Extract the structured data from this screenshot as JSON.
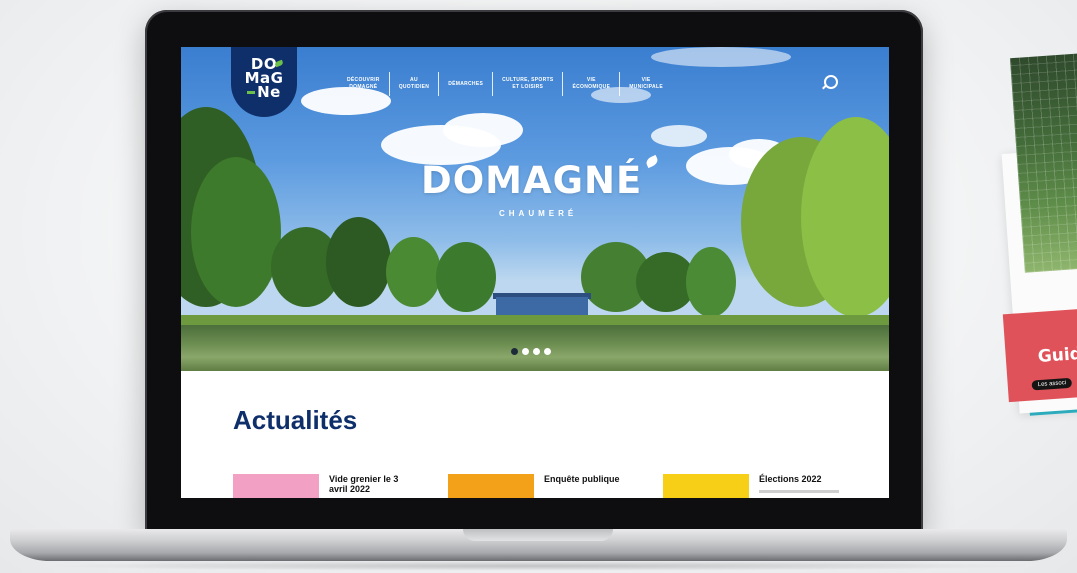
{
  "brochure": {
    "title": "Guide",
    "subtitle": "Les associ"
  },
  "site": {
    "logo_lines": [
      "DO",
      "MaG",
      "Ne"
    ],
    "nav": [
      {
        "label": "Découvrir\nDomagné"
      },
      {
        "label": "Au\nquotidien"
      },
      {
        "label": "Démarches"
      },
      {
        "label": "Culture, sports\net loisirs"
      },
      {
        "label": "Vie\néconomique"
      },
      {
        "label": "Vie\nmunicipale"
      }
    ],
    "search_icon": "search-icon",
    "hero_title": "DOMAGNÉ",
    "hero_subtitle": "CHAUMERÉ",
    "slider": {
      "count": 4,
      "active_index": 0
    }
  },
  "news": {
    "heading": "Actualités",
    "cards": [
      {
        "title": "Vide grenier le 3 avril 2022",
        "color": "#f2a1c4"
      },
      {
        "title": "Enquête publique",
        "color": "#f4a11a"
      },
      {
        "title": "Élections 2022",
        "color": "#f6cf16"
      }
    ]
  }
}
